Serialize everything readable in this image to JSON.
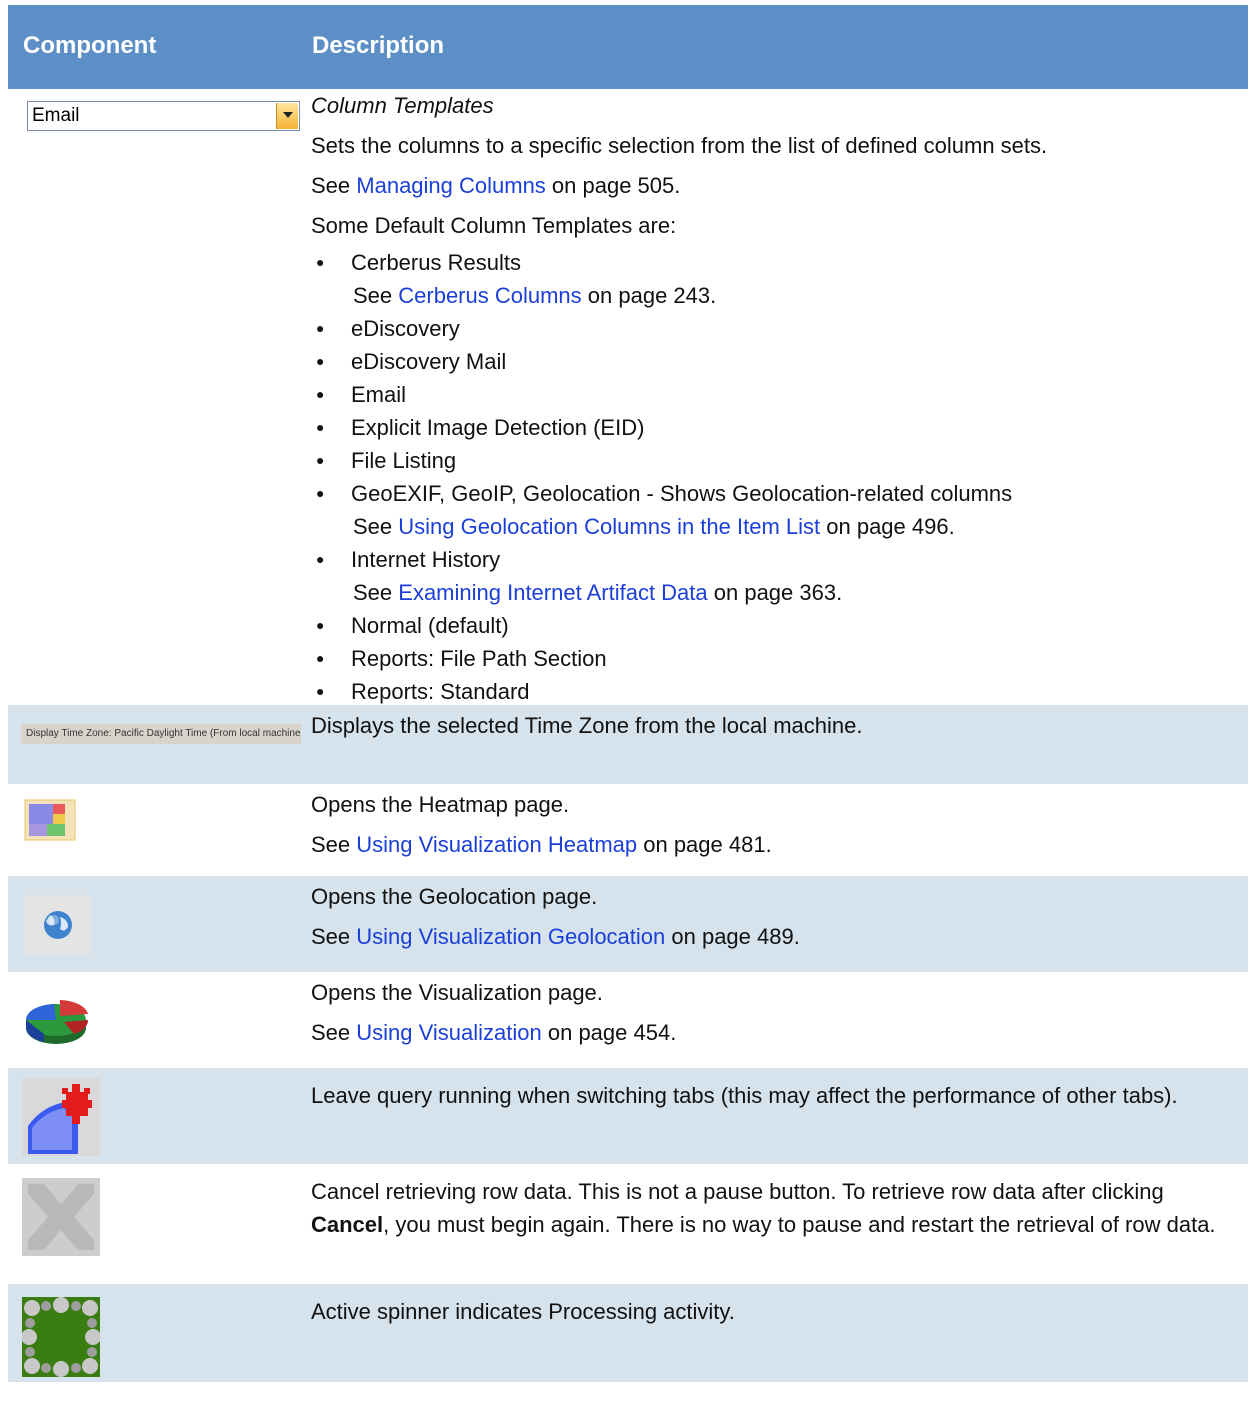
{
  "header": {
    "component": "Component",
    "description": "Description"
  },
  "columns_row": {
    "combo_value": "Email",
    "title": "Column Templates",
    "text1": "Sets the columns to a specific selection from the list of defined column sets.",
    "see_prefix": "See ",
    "link": "Managing Columns",
    "page": " on page 505.",
    "intro": "Some Default Column Templates are:",
    "items": [
      {
        "label": "Cerberus Results",
        "see": "See ",
        "link": "Cerberus Columns",
        "page": " on page 243."
      },
      {
        "label": "eDiscovery"
      },
      {
        "label": "eDiscovery Mail"
      },
      {
        "label": "Email"
      },
      {
        "label": "Explicit Image Detection (EID)"
      },
      {
        "label": "File Listing"
      },
      {
        "label": "GeoEXIF, GeoIP, Geolocation - Shows Geolocation-related columns",
        "see": "See ",
        "link": "Using Geolocation Columns in the Item List",
        "page": " on page 496."
      },
      {
        "label": "Internet History",
        "see": "See ",
        "link": "Examining Internet Artifact Data",
        "page": " on page 363."
      },
      {
        "label": "Normal (default)"
      },
      {
        "label": "Reports: File Path Section"
      },
      {
        "label": "Reports: Standard"
      }
    ]
  },
  "timezone_row": {
    "bar_text": "Display Time Zone: Pacific Daylight Time  (From local machine)",
    "desc": "Displays the selected Time Zone from the local machine."
  },
  "heatmap_row": {
    "icon": "heatmap-icon",
    "desc": "Opens the Heatmap page.",
    "see": "See ",
    "link": "Using Visualization Heatmap",
    "page": " on page 481."
  },
  "geo_row": {
    "icon": "globe-icon",
    "desc": "Opens the Geolocation page.",
    "see": "See ",
    "link": "Using Visualization Geolocation",
    "page": " on page 489."
  },
  "viz_row": {
    "icon": "pie-chart-icon",
    "desc": "Opens the Visualization page.",
    "see": "See ",
    "link": "Using Visualization",
    "page": " on page 454."
  },
  "leave_row": {
    "icon": "leave-running-icon",
    "desc": "Leave query running when switching tabs (this may affect the performance of other tabs)."
  },
  "cancel_row": {
    "icon": "cancel-x-icon",
    "desc1": "Cancel retrieving row data. This is not a pause button. To retrieve row data after clicking ",
    "bold": "Cancel",
    "desc2": ", you must begin again. There is no way to pause and restart the retrieval of row data."
  },
  "spinner_row": {
    "icon": "spinner-icon",
    "desc": "Active spinner indicates Processing activity."
  },
  "colors": {
    "header": "#5d8fc7",
    "alt_row": "#d6e3ec",
    "link": "#1b3fd8"
  }
}
